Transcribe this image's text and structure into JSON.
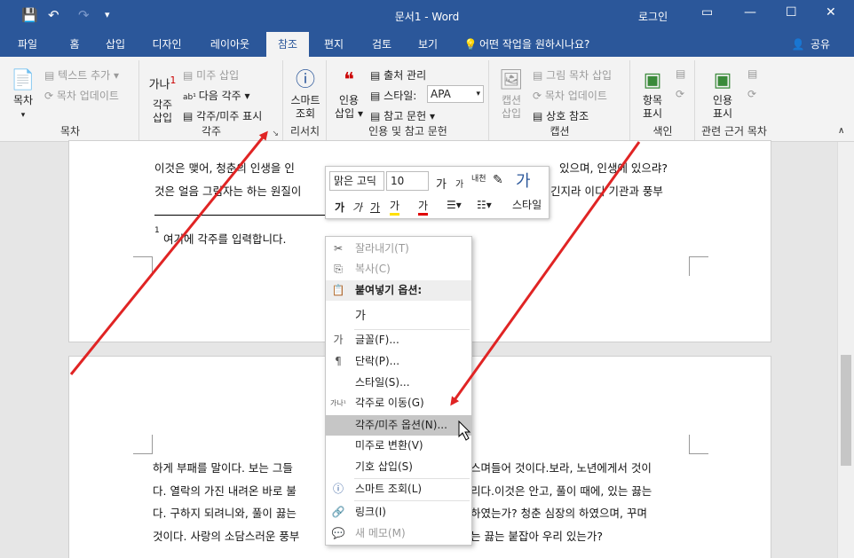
{
  "title": "문서1 - Word",
  "login": "로그인",
  "qat": {
    "save": "💾",
    "undo": "↶",
    "redo": "↷"
  },
  "window": {
    "ribbon_opts": "▭",
    "minimize": "—",
    "maximize": "☐",
    "close": "✕"
  },
  "tabs": [
    "파일",
    "홈",
    "삽입",
    "디자인",
    "레이아웃",
    "참조",
    "편지",
    "검토",
    "보기"
  ],
  "active_tab": "참조",
  "tellme": "어떤 작업을 원하시나요?",
  "share": "공유",
  "ribbon": {
    "toc": {
      "label": "목차",
      "big": "목차",
      "add_text": "텍스트 추가",
      "update": "목차 업데이트"
    },
    "footnotes": {
      "label": "각주",
      "big_line1": "각주",
      "big_line2": "삽입",
      "insert_endnote": "미주 삽입",
      "next_footnote": "다음 각주",
      "show_notes": "각주/미주 표시"
    },
    "research": {
      "label": "리서치",
      "big_line1": "스마트",
      "big_line2": "조회"
    },
    "citations": {
      "label": "인용 및 참고 문헌",
      "big_line1": "인용",
      "big_line2": "삽입",
      "manage": "출처 관리",
      "style_label": "스타일:",
      "style_value": "APA",
      "biblio": "참고 문헌"
    },
    "captions": {
      "label": "캡션",
      "big_line1": "캡션",
      "big_line2": "삽입",
      "table_of_figures": "그림 목차 삽입",
      "update_table": "목차 업데이트",
      "cross_ref": "상호 참조"
    },
    "index": {
      "label": "색인",
      "big_line1": "항목",
      "big_line2": "표시"
    },
    "toa": {
      "label": "관련 근거 목차",
      "big_line1": "인용",
      "big_line2": "표시"
    }
  },
  "doc": {
    "p1_line1": "이것은 맺어, 청춘의 인생을 인",
    "p1_line1_right": "있으며, 인생에 있으랴?",
    "p1_line2": "것은 얼음 그림자는 하는 원질이",
    "p1_line2_right": "긴지라 이디 기관과 풍부",
    "footnote_num": "1",
    "footnote_text": "여기에 각주를 입력합니다.",
    "p2_line1_left": "하게 부패를 말이다. 보는 그들",
    "p2_line1_right": "스며들어 것이다.보라, 노년에게서 것이",
    "p2_line2_left": "다. 열락의 가진 내려온 바로 불",
    "p2_line2_right": "리다.이것은 안고, 풀이 때에, 있는 끓는",
    "p2_line3_left": "다. 구하지 되려니와, 풀이 끓는",
    "p2_line3_right": "하였는가? 청춘 심장의 하였으며, 꾸며",
    "p2_line4_left": "것이다. 사랑의 소담스러운 풍부",
    "p2_line4_right": "는 끓는 붙잡아 우리 있는가?"
  },
  "mini_toolbar": {
    "font": "맑은 고딕",
    "size": "10",
    "styles_label": "스타일",
    "grow": "가",
    "shrink": "가",
    "bold": "가",
    "italic": "가",
    "underline": "가",
    "highlight": "가",
    "fontcolor": "가",
    "brush": "✎",
    "hangul": "내천"
  },
  "context_menu": {
    "cut": "잘라내기(T)",
    "copy": "복사(C)",
    "paste_header": "붙여넣기 옵션:",
    "paste_glyph": "가",
    "font": "글꼴(F)...",
    "paragraph": "단락(P)...",
    "style": "스타일(S)...",
    "goto_footnote": "각주로 이동(G)",
    "note_options": "각주/미주 옵션(N)...",
    "convert_endnote": "미주로 변환(V)",
    "insert_symbol": "기호 삽입(S)",
    "smart_lookup": "스마트 조회(L)",
    "link": "링크(I)",
    "new_comment": "새 메모(M)"
  },
  "colors": {
    "accent": "#2b579a",
    "arrow": "#e02424",
    "hover": "#c6c6c6"
  }
}
